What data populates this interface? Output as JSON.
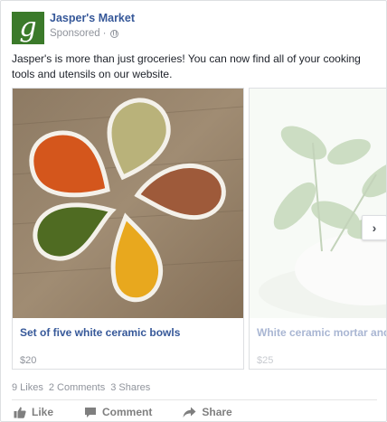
{
  "post": {
    "page_name": "Jasper's Market",
    "avatar_letter": "g",
    "sponsored_label": "Sponsored",
    "separator": "·",
    "text": "Jasper's is more than just groceries! You can now find all of your cooking tools and utensils on our website."
  },
  "carousel": {
    "items": [
      {
        "title": "Set of five white ceramic bowls",
        "price": "$20"
      },
      {
        "title": "White ceramic mortar and pes",
        "price": "$25"
      }
    ]
  },
  "stats": {
    "likes": "9 Likes",
    "comments": "2 Comments",
    "shares": "3 Shares"
  },
  "actions": {
    "like": "Like",
    "comment": "Comment",
    "share": "Share"
  },
  "colors": {
    "link_blue": "#365899",
    "muted_gray": "#90949c",
    "avatar_green": "#3b7a2a"
  }
}
